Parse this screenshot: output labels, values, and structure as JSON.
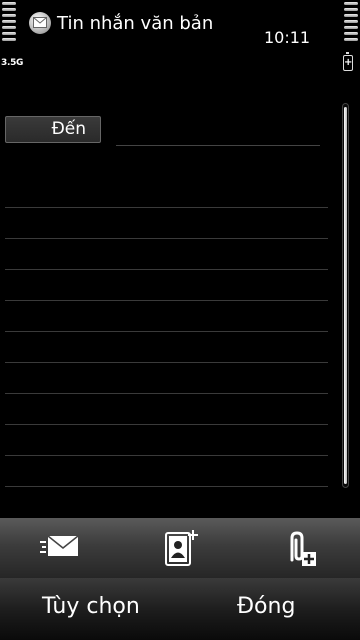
{
  "status": {
    "app_title": "Tin nhắn văn bản",
    "time": "10:11",
    "network": "3.5G"
  },
  "recipient": {
    "to_label": "Đến",
    "value": ""
  },
  "message": {
    "body": ""
  },
  "toolbar": {
    "items": [
      {
        "name": "send",
        "icon": "envelope-icon"
      },
      {
        "name": "add-recipient",
        "icon": "contacts-add-icon"
      },
      {
        "name": "attach",
        "icon": "paperclip-add-icon"
      }
    ]
  },
  "softkeys": {
    "left_label": "Tùy chọn",
    "right_label": "Đóng"
  },
  "colors": {
    "background": "#000000",
    "text": "#ffffff",
    "rule_line": "#3a3a3a"
  }
}
